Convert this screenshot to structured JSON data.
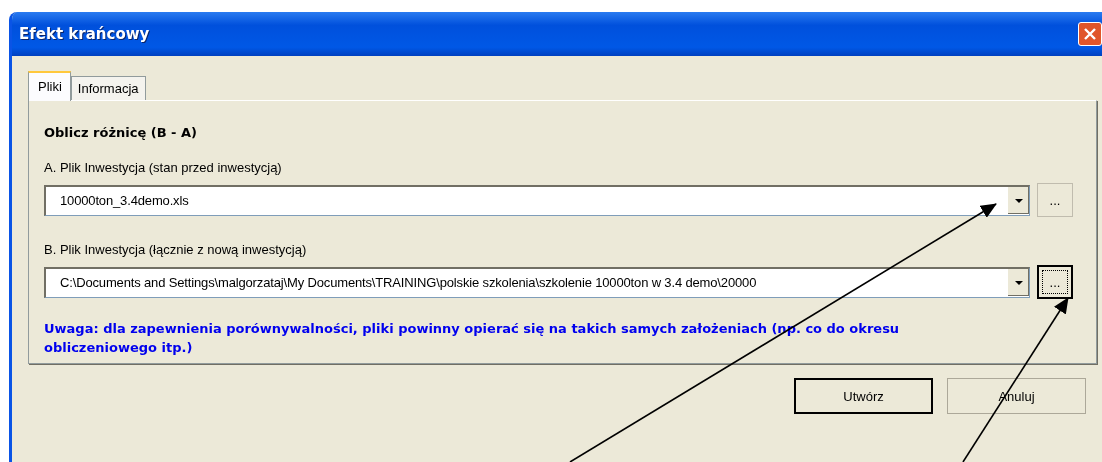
{
  "window": {
    "title": "Efekt krańcowy"
  },
  "tabs": [
    {
      "label": "Pliki",
      "selected": true
    },
    {
      "label": "Informacja",
      "selected": false
    }
  ],
  "panel": {
    "heading": "Oblicz różnicę (B - A)",
    "files": [
      {
        "label": "A. Plik Inwestycja (stan przed inwestycją)",
        "value": "10000ton_3.4demo.xls",
        "browse": "...",
        "focused": false
      },
      {
        "label": "B. Plik Inwestycja (łącznie z nową inwestycją)",
        "value": "C:\\Documents and Settings\\malgorzataj\\My Documents\\TRAINING\\polskie szkolenia\\szkolenie 10000ton w 3.4 demo\\20000",
        "browse": "...",
        "focused": true
      }
    ],
    "note": "Uwaga: dla zapewnienia porównywalności, pliki powinny opierać się na takich samych założeniach (np. co do okresu obliczeniowego itp.)"
  },
  "buttons": [
    {
      "label": "Utwórz",
      "default": true
    },
    {
      "label": "Anuluj",
      "default": false
    }
  ]
}
